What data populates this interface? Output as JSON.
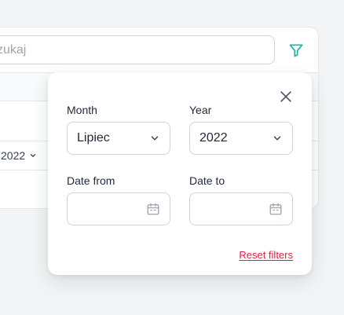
{
  "search": {
    "value": "zukaj"
  },
  "background": {
    "year_value": "2022"
  },
  "filters": {
    "month": {
      "label": "Month",
      "value": "Lipiec"
    },
    "year": {
      "label": "Year",
      "value": "2022"
    },
    "date_from": {
      "label": "Date from",
      "value": ""
    },
    "date_to": {
      "label": "Date to",
      "value": ""
    },
    "reset_label": "Reset filters"
  },
  "icons": {
    "filter": "filter-icon",
    "close": "close-icon",
    "chevron": "chevron-down-icon",
    "calendar": "calendar-icon"
  },
  "colors": {
    "accent": "#14b8a6",
    "danger": "#e11d48"
  }
}
